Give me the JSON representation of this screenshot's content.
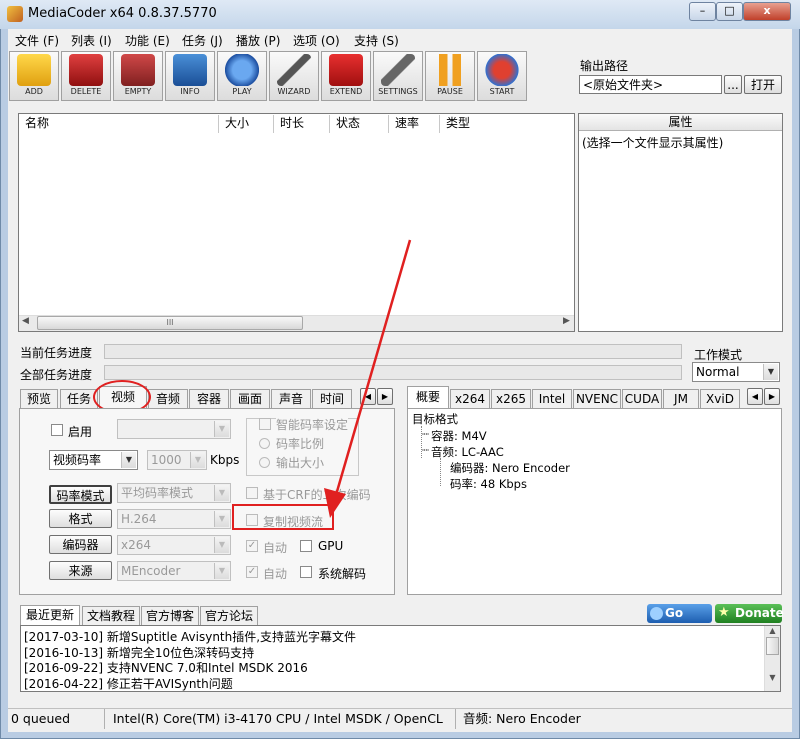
{
  "window": {
    "title": "MediaCoder x64 0.8.37.5770",
    "min": "–",
    "max": "□",
    "close": "x"
  },
  "menu": [
    "文件 (F)",
    "列表 (I)",
    "功能 (E)",
    "任务 (J)",
    "播放 (P)",
    "选项 (O)",
    "支持 (S)"
  ],
  "toolbar": [
    "ADD",
    "DELETE",
    "EMPTY",
    "INFO",
    "PLAY",
    "WIZARD",
    "EXTEND",
    "SETTINGS",
    "PAUSE",
    "START"
  ],
  "output": {
    "label": "输出路径",
    "value": "<原始文件夹>",
    "browse": "...",
    "open": "打开"
  },
  "filelist": {
    "columns": [
      "名称",
      "大小",
      "时长",
      "状态",
      "速率",
      "类型"
    ],
    "scroll_thumb": "III"
  },
  "props": {
    "header": "属性",
    "hint": "(选择一个文件显示其属性)"
  },
  "progress": {
    "current": "当前任务进度",
    "all": "全部任务进度"
  },
  "workmode": {
    "label": "工作模式",
    "value": "Normal"
  },
  "left_tabs": [
    "预览",
    "任务",
    "视频",
    "音频",
    "容器",
    "画面",
    "声音",
    "时间"
  ],
  "video": {
    "enable": "启用",
    "rate_mode_select": "视频码率",
    "bitrate": "1000",
    "kbps": "Kbps",
    "smart_rate": "智能码率设定",
    "rate_ratio": "码率比例",
    "output_size": "输出大小",
    "btn_rate_mode": "码率模式",
    "rate_mode_value": "平均码率模式",
    "crf": "基于CRF的二次编码",
    "btn_format": "格式",
    "format_value": "H.264",
    "copy_stream": "复制视频流",
    "btn_encoder": "编码器",
    "encoder_value": "x264",
    "auto1": "自动",
    "gpu": "GPU",
    "btn_source": "来源",
    "source_value": "MEncoder",
    "auto2": "自动",
    "sys_decode": "系统解码"
  },
  "right_tabs": [
    "概要",
    "x264",
    "x265",
    "Intel",
    "NVENC",
    "CUDA",
    "JM",
    "XviD"
  ],
  "summary": [
    "目标格式",
    "容器: M4V",
    "音频: LC-AAC",
    "编码器: Nero Encoder",
    "码率: 48 Kbps"
  ],
  "bottom_tabs": [
    "最近更新",
    "文档教程",
    "官方博客",
    "官方论坛"
  ],
  "go_pro": "Go PRO",
  "donate": "Donate",
  "news": [
    "[2017-03-10] 新增Suptitle Avisynth插件,支持蓝光字幕文件",
    "[2016-10-13] 新增完全10位色深转码支持",
    "[2016-09-22] 支持NVENC 7.0和Intel MSDK 2016",
    "[2016-04-22] 修正若干AVISynth问题"
  ],
  "status": [
    "0 queued",
    "Intel(R) Core(TM) i3-4170 CPU  / Intel MSDK / OpenCL",
    "音频: Nero Encoder"
  ],
  "colors": {
    "highlight": "#e02020",
    "arrow": "#e02020"
  }
}
